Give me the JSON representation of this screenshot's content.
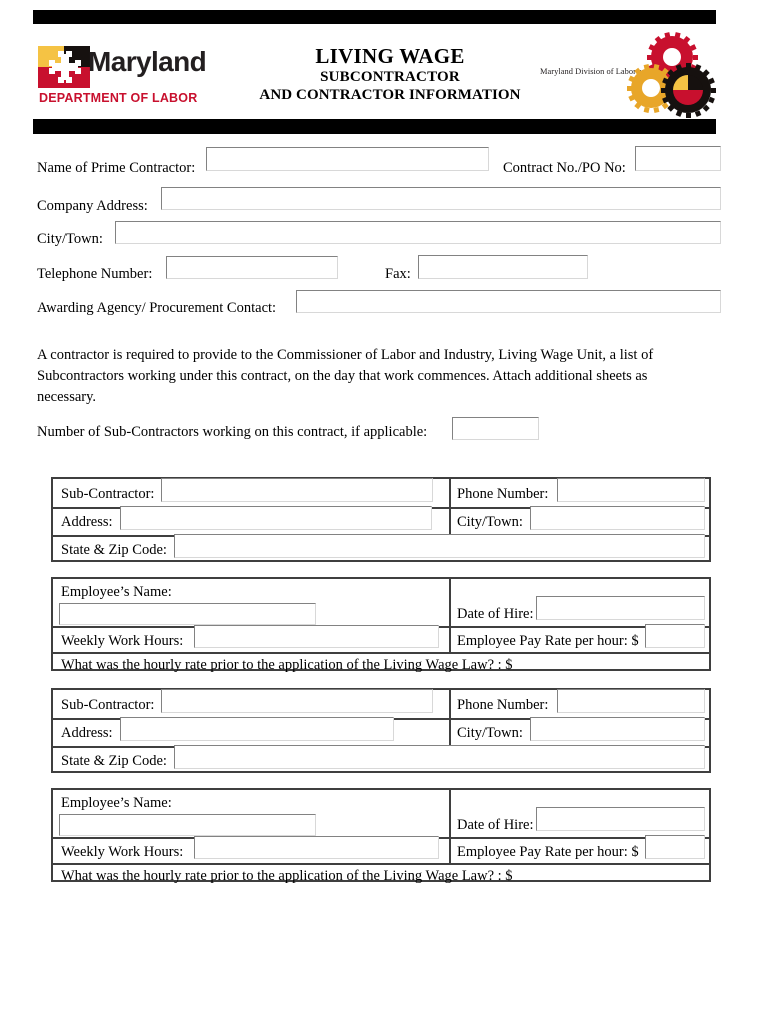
{
  "header": {
    "logo": {
      "wordmark": "Maryland",
      "department": "DEPARTMENT OF LABOR"
    },
    "title_main": "LIVING WAGE",
    "title_sub1": "SUBCONTRACTOR",
    "title_sub2": "AND CONTRACTOR INFORMATION",
    "division_text": "Maryland Division of Labor and Industry"
  },
  "contractor": {
    "name_label": "Name of Prime Contractor:",
    "name_value": "",
    "contract_no_label": "Contract No./PO No:",
    "contract_no_value": "",
    "address_label": "Company Address:",
    "address_value": "",
    "city_label": "City/Town:",
    "city_value": "",
    "telephone_label": "Telephone Number:",
    "telephone_value": "",
    "fax_label": "Fax:",
    "fax_value": "",
    "agency_label": "Awarding Agency/ Procurement Contact:",
    "agency_value": ""
  },
  "notice": {
    "paragraph": "A contractor is required to provide to the Commissioner of Labor and Industry, Living Wage Unit, a list of Subcontractors working under this contract, on the day that work commences. Attach additional sheets as necessary.",
    "count_label": "Number of Sub-Contractors working on this contract, if applicable:",
    "count_value": ""
  },
  "subcontractor_blocks": [
    {
      "sub_label": "Sub-Contractor:",
      "sub_value": "",
      "phone_label": "Phone Number:",
      "phone_value": "",
      "address_label": "Address:",
      "address_value": "",
      "city_label": "City/Town:",
      "city_value": "",
      "state_zip_label": "State & Zip Code:",
      "state_zip_value": ""
    },
    {
      "sub_label": "Sub-Contractor:",
      "sub_value": "",
      "phone_label": "Phone Number:",
      "phone_value": "",
      "address_label": "Address:",
      "address_value": "",
      "city_label": "City/Town:",
      "city_value": "",
      "state_zip_label": "State & Zip Code:",
      "state_zip_value": ""
    }
  ],
  "employee_blocks": [
    {
      "name_label": "Employee’s Name:",
      "name_value": "",
      "hire_label": "Date of Hire:",
      "hire_value": "",
      "hours_label": "Weekly Work Hours:",
      "hours_value": "",
      "payrate_label": "Employee Pay Rate per hour: $",
      "payrate_value": "",
      "prior_rate_label": "What was the hourly rate prior to the application of the Living Wage Law? : $",
      "prior_rate_value": ""
    },
    {
      "name_label": "Employee’s Name:",
      "name_value": "",
      "hire_label": "Date of Hire:",
      "hire_value": "",
      "hours_label": "Weekly Work Hours:",
      "hours_value": "",
      "payrate_label": "Employee Pay Rate per hour: $",
      "payrate_value": "",
      "prior_rate_label": "What was the hourly rate prior to the application of the Living Wage Law? : $",
      "prior_rate_value": ""
    }
  ],
  "colors": {
    "maryland_red": "#c8102e",
    "maryland_gold": "#f5c344",
    "rule_black": "#000000"
  }
}
